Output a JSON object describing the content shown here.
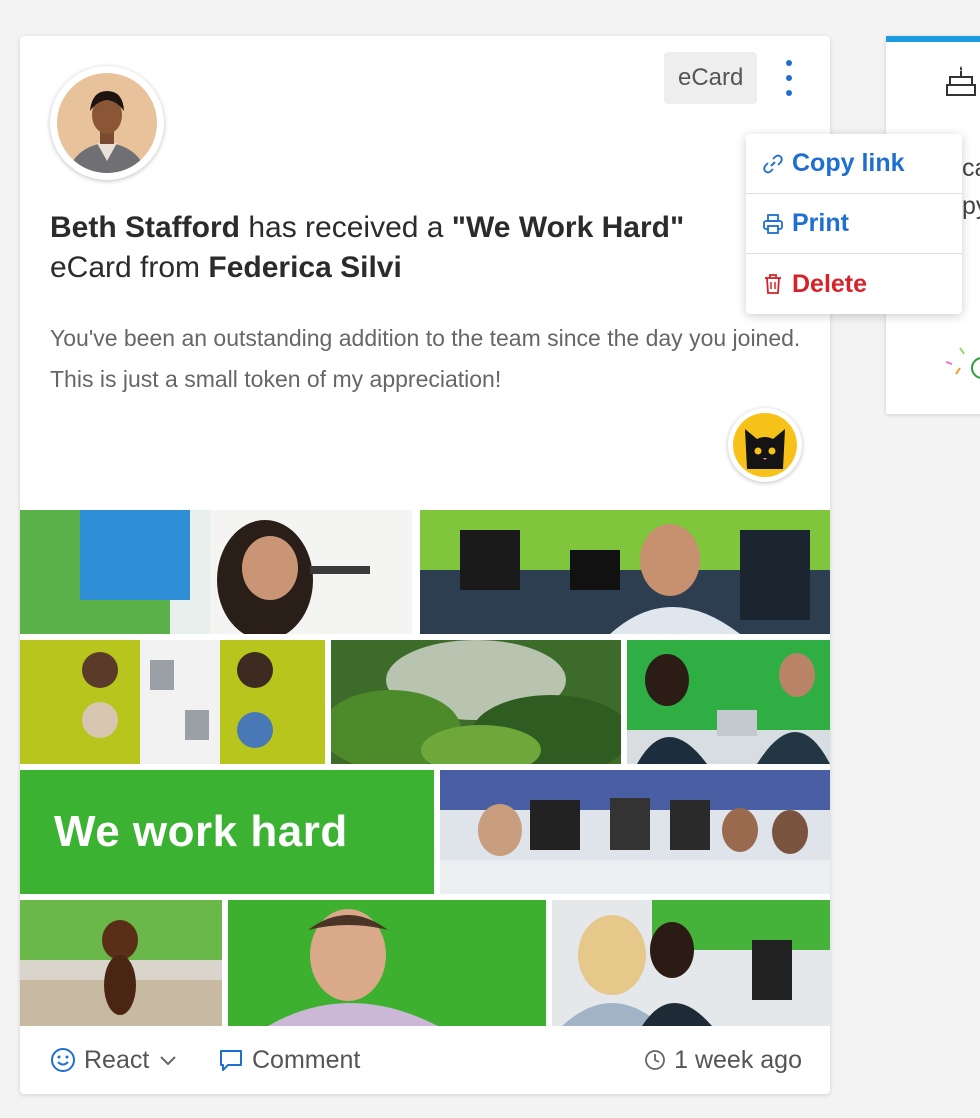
{
  "post": {
    "recipient": "Beth Stafford",
    "mid_text": " has received a ",
    "card_name": "\"We Work Hard\"",
    "line2_prefix": "eCard from ",
    "sender": "Federica Silvi",
    "message": "You've been an outstanding addition to the team since the day you joined. This is just a small token of my appreciation!",
    "tag": "eCard",
    "banner_text": "We work hard",
    "timestamp": "1 week ago"
  },
  "actions": {
    "react_label": "React",
    "comment_label": "Comment"
  },
  "menu": {
    "copy_link": "Copy link",
    "print": "Print",
    "delete": "Delete"
  },
  "side_card": {
    "fragment1": "ca",
    "fragment2": "py"
  },
  "colors": {
    "accent": "#1f6fd0",
    "danger": "#d72229",
    "banner_green": "#3cb232",
    "side_card_top": "#1d9be0"
  },
  "icons": [
    "kebab-menu-icon",
    "link-icon",
    "printer-icon",
    "trash-icon",
    "smiley-icon",
    "chevron-down-icon",
    "comment-icon",
    "clock-icon",
    "cake-icon"
  ]
}
